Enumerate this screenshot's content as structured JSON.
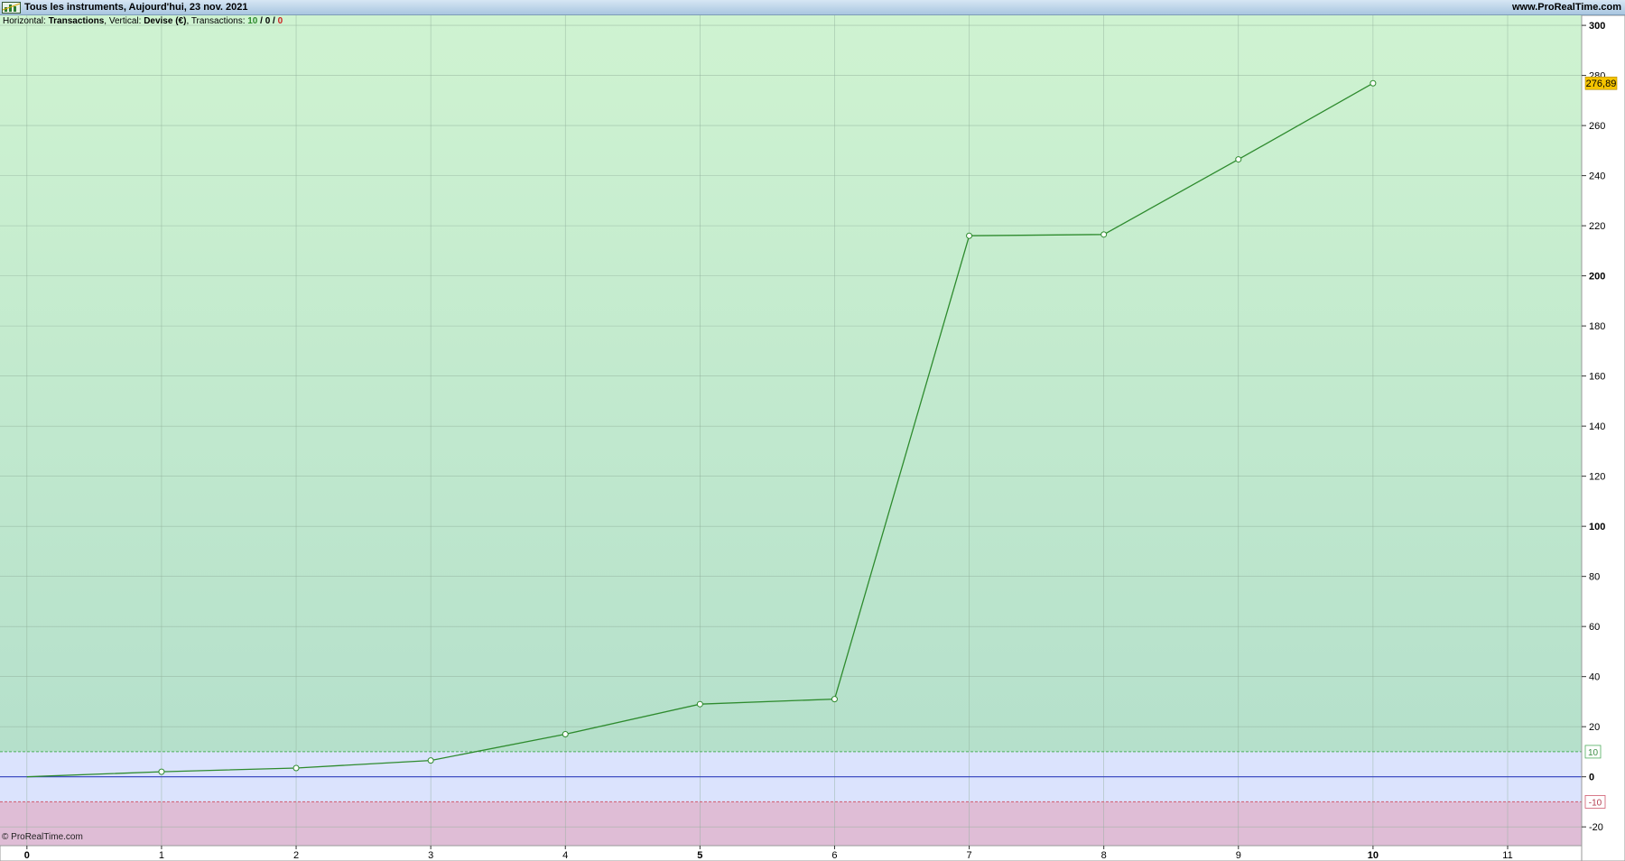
{
  "window": {
    "title": "Tous les instruments, Aujourd'hui, 23 nov. 2021",
    "site": "www.ProRealTime.com"
  },
  "infobar": {
    "horizontal_label": "Horizontal: ",
    "horizontal_value": "Transactions",
    "vertical_label": ", Vertical: ",
    "vertical_value": "Devise (€)",
    "transactions_label": ", Transactions: ",
    "winning": "10",
    "sep1": " / ",
    "neutral": "0",
    "sep2": " / ",
    "losing": "0"
  },
  "footer": {
    "copyright": "© ProRealTime.com"
  },
  "chart_data": {
    "type": "line",
    "x": [
      0,
      1,
      2,
      3,
      4,
      5,
      6,
      7,
      8,
      9,
      10
    ],
    "values": [
      0,
      2,
      3.5,
      6.5,
      17,
      29,
      31,
      216,
      216.5,
      246.5,
      276.89
    ],
    "xlim": [
      -0.2,
      11.55
    ],
    "ylim": [
      -27.5,
      304
    ],
    "xticks": [
      "0",
      "1",
      "2",
      "3",
      "4",
      "5",
      "6",
      "7",
      "8",
      "9",
      "10",
      "11"
    ],
    "xticks_bold": [
      "0",
      "5",
      "10"
    ],
    "yticks": [
      -20,
      0,
      20,
      40,
      60,
      80,
      100,
      120,
      140,
      160,
      180,
      200,
      220,
      240,
      260,
      280,
      300
    ],
    "yticks_bold": [
      0,
      100,
      200,
      300
    ],
    "zero_line": 0,
    "upper_band": 10,
    "lower_band": -10,
    "last_value_label": "276,89",
    "band_labels": {
      "upper": "10",
      "lower": "-10"
    },
    "grid": true,
    "colors": {
      "line": "#2e8b2e",
      "marker_fill": "#ffffff",
      "zero_line": "#2f3fbf",
      "upper_band_line": "#4fae5c",
      "lower_band_line": "#d05a6e",
      "last_value_bg": "#f5c400",
      "bg_top": "#cff3d1",
      "bg_bottom": "#b5e0cb",
      "neutral_zone": "#dbe3fd",
      "negative_zone": "#dfbdd6"
    }
  }
}
